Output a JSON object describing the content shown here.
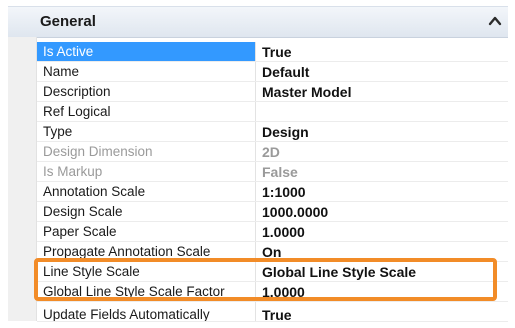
{
  "header": {
    "title": "General",
    "collapse_icon": "chevron-up-icon"
  },
  "properties": [
    {
      "name": "Is Active",
      "value": "True",
      "state": "selected"
    },
    {
      "name": "Name",
      "value": "Default",
      "state": "normal"
    },
    {
      "name": "Description",
      "value": "Master Model",
      "state": "normal"
    },
    {
      "name": "Ref Logical",
      "value": "",
      "state": "normal"
    },
    {
      "name": "Type",
      "value": "Design",
      "state": "normal"
    },
    {
      "name": "Design Dimension",
      "value": "2D",
      "state": "disabled"
    },
    {
      "name": "Is Markup",
      "value": "False",
      "state": "disabled"
    },
    {
      "name": "Annotation Scale",
      "value": "1:1000",
      "state": "normal"
    },
    {
      "name": "Design Scale",
      "value": "1000.0000",
      "state": "normal"
    },
    {
      "name": "Paper Scale",
      "value": "1.0000",
      "state": "normal"
    },
    {
      "name": "Propagate Annotation Scale",
      "value": "On",
      "state": "normal"
    },
    {
      "name": "Line Style Scale",
      "value": "Global Line Style Scale",
      "state": "normal"
    },
    {
      "name": "Global Line Style Scale Factor",
      "value": "1.0000",
      "state": "normal"
    },
    {
      "name": "Update Fields Automatically",
      "value": "True",
      "state": "normal"
    }
  ],
  "colors": {
    "selection": "#3399ff",
    "highlight_frame": "#f28c28",
    "disabled_text": "#9a9a9a"
  }
}
